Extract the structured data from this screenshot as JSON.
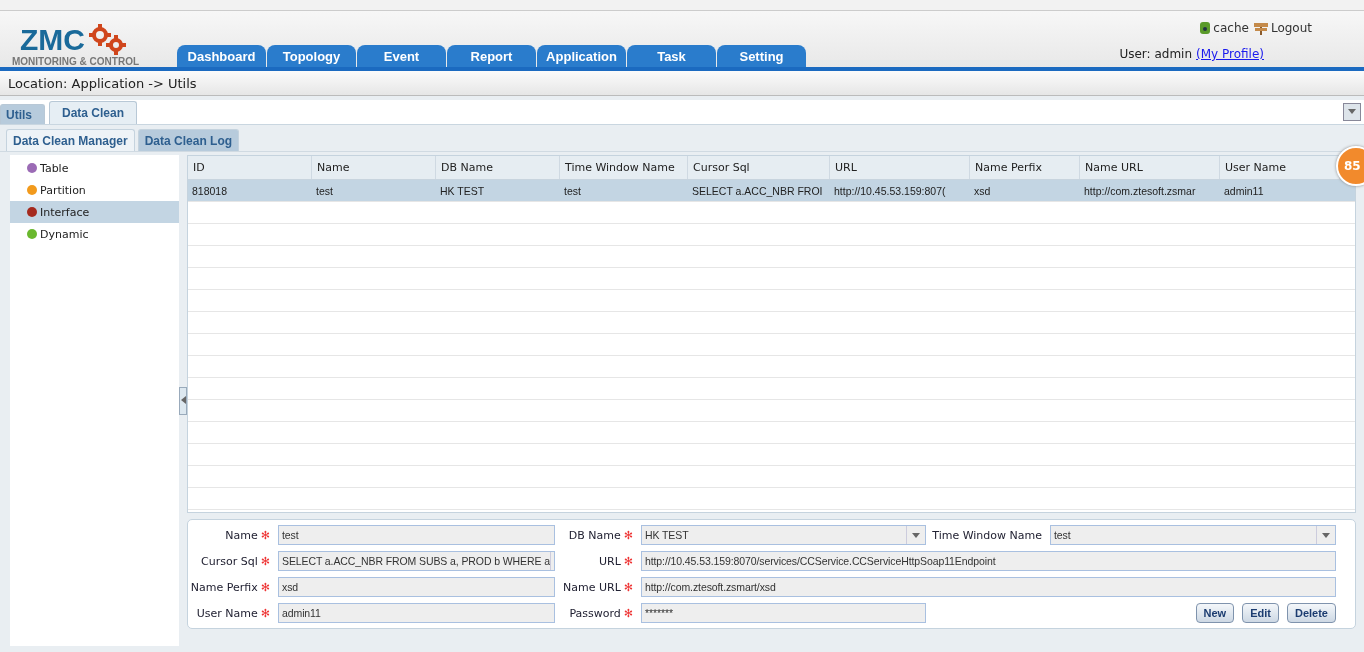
{
  "header": {
    "logo": "ZMC",
    "logo_subtitle": "MONITORING & CONTROL",
    "links": [
      {
        "kind": "cache",
        "label": "cache"
      },
      {
        "kind": "logout",
        "label": "Logout"
      }
    ],
    "user_label": "User: admin",
    "profile_link": "(My Profile)"
  },
  "nav_tabs": [
    {
      "label": "Dashboard",
      "selected": false
    },
    {
      "label": "Topology",
      "selected": false
    },
    {
      "label": "Event",
      "selected": false
    },
    {
      "label": "Report",
      "selected": false
    },
    {
      "label": "Application",
      "selected": false
    },
    {
      "label": "Task",
      "selected": false
    },
    {
      "label": "Setting",
      "selected": false
    }
  ],
  "location": "Location: Application -> Utils",
  "page_tabs": [
    {
      "label": "Utils",
      "selected": false
    },
    {
      "label": "Data Clean",
      "selected": true
    }
  ],
  "sub_tabs": [
    {
      "label": "Data Clean Manager",
      "selected": true
    },
    {
      "label": "Data Clean Log",
      "selected": false
    }
  ],
  "tree": [
    {
      "label": "Table",
      "color": "#9b6bb5",
      "selected": false
    },
    {
      "label": "Partition",
      "color": "#f29a1c",
      "selected": false
    },
    {
      "label": "Interface",
      "color": "#a52a1e",
      "selected": true
    },
    {
      "label": "Dynamic",
      "color": "#6ab82e",
      "selected": false
    }
  ],
  "table": {
    "columns": [
      "ID",
      "Name",
      "DB Name",
      "Time Window Name",
      "Cursor Sql",
      "URL",
      "Name Perfix",
      "Name URL",
      "User Name"
    ],
    "rows": [
      {
        "selected": true,
        "cells": [
          "818018",
          "test",
          "HK TEST",
          "test",
          "SELECT a.ACC_NBR FROI",
          "http://10.45.53.159:807(",
          "xsd",
          "http://com.ztesoft.zsmar",
          "admin11"
        ]
      }
    ]
  },
  "badge": "85",
  "form": {
    "fields": [
      {
        "label": "Name",
        "kind": "text",
        "value": "test",
        "required": true
      },
      {
        "label": "DB Name",
        "kind": "select",
        "value": "HK TEST",
        "required": true
      },
      {
        "label": "Time Window Name",
        "kind": "select",
        "value": "test",
        "required": false
      },
      {
        "label": "Cursor Sql",
        "kind": "picker",
        "value": "SELECT a.ACC_NBR FROM SUBS a, PROD b WHERE  a",
        "required": true
      },
      {
        "label": "URL",
        "kind": "wide",
        "value": "http://10.45.53.159:8070/services/CCService.CCServiceHttpSoap11Endpoint",
        "required": true
      },
      {
        "label": "Name Perfix",
        "kind": "text",
        "value": "xsd",
        "required": true
      },
      {
        "label": "Name URL",
        "kind": "wide",
        "value": "http://com.ztesoft.zsmart/xsd",
        "required": true
      },
      {
        "label": "User Name",
        "kind": "text",
        "value": "admin11",
        "required": true
      },
      {
        "label": "Password",
        "kind": "text",
        "value": "*******",
        "required": true
      }
    ],
    "required_mark": "✻",
    "buttons": [
      "New",
      "Edit",
      "Delete"
    ]
  }
}
